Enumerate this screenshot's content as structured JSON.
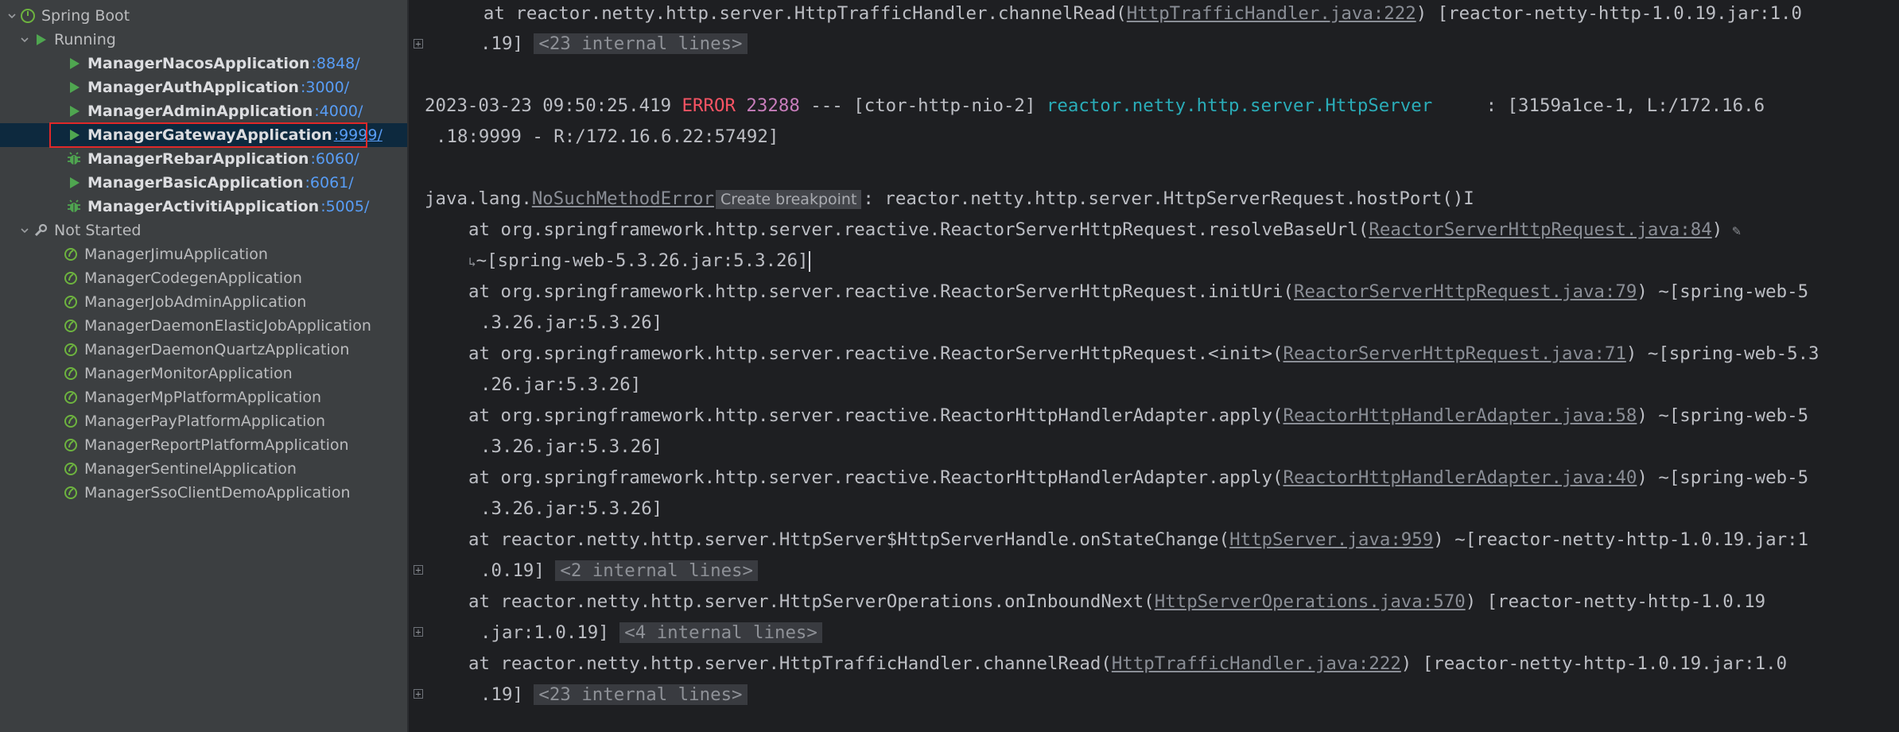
{
  "sidebar": {
    "root": {
      "label": "Spring Boot"
    },
    "running_group": {
      "label": "Running"
    },
    "running": [
      {
        "name": "ManagerNacosApplication",
        "port": ":8848/",
        "icon": "run-icon"
      },
      {
        "name": "ManagerAuthApplication",
        "port": ":3000/",
        "icon": "run-icon"
      },
      {
        "name": "ManagerAdminApplication",
        "port": ":4000/",
        "icon": "run-icon"
      },
      {
        "name": "ManagerGatewayApplication",
        "port": ":9999/",
        "icon": "run-icon",
        "selected": true
      },
      {
        "name": "ManagerRebarApplication",
        "port": ":6060/",
        "icon": "debug-icon"
      },
      {
        "name": "ManagerBasicApplication",
        "port": ":6061/",
        "icon": "run-icon"
      },
      {
        "name": "ManagerActivitiApplication",
        "port": ":5005/",
        "icon": "debug-icon"
      }
    ],
    "not_started_group": {
      "label": "Not Started"
    },
    "not_started": [
      "ManagerJimuApplication",
      "ManagerCodegenApplication",
      "ManagerJobAdminApplication",
      "ManagerDaemonElasticJobApplication",
      "ManagerDaemonQuartzApplication",
      "ManagerMonitorApplication",
      "ManagerMpPlatformApplication",
      "ManagerPayPlatformApplication",
      "ManagerReportPlatformApplication",
      "ManagerSentinelApplication",
      "ManagerSsoClientDemoApplication"
    ]
  },
  "console": {
    "l1": {
      "a": "    at reactor.netty.http.server.HttpTrafficHandler.channelRead(",
      "link": "HttpTrafficHandler.java:222",
      "b": ") [reactor-netty-http-1.0.19.jar:1.0"
    },
    "l2": {
      "a": ".19] ",
      "fold": "<23 internal lines>"
    },
    "l3": {
      "ts": "2023-03-23 09:50:25.419 ",
      "level": "ERROR",
      "sp": " ",
      "pid": "23288",
      "mid": " --- [ctor-http-nio-2] ",
      "logger": "reactor.netty.http.server.HttpServer",
      "msg": "     : [3159a1ce-1, L:/172.16.6"
    },
    "l4": {
      "a": ".18:9999 - R:/172.16.6.22:57492]"
    },
    "l5": {
      "a": "java.lang.",
      "link": "NoSuchMethodError",
      "tip": "Create breakpoint",
      "b": ": reactor.netty.http.server.HttpServerRequest.hostPort()I"
    },
    "l6": {
      "a": "at org.springframework.http.server.reactive.ReactorServerHttpRequest.resolveBaseUrl(",
      "link": "ReactorServerHttpRequest.java:84",
      "b": ")"
    },
    "l7": {
      "a": "~[spring-web-5.3.26.jar:5.3.26]"
    },
    "l8": {
      "a": "at org.springframework.http.server.reactive.ReactorServerHttpRequest.initUri(",
      "link": "ReactorServerHttpRequest.java:79",
      "b": ") ~[spring-web-5"
    },
    "l9": {
      "a": ".3.26.jar:5.3.26]"
    },
    "l10": {
      "a": "at org.springframework.http.server.reactive.ReactorServerHttpRequest.<init>(",
      "link": "ReactorServerHttpRequest.java:71",
      "b": ") ~[spring-web-5.3"
    },
    "l11": {
      "a": ".26.jar:5.3.26]"
    },
    "l12": {
      "a": "at org.springframework.http.server.reactive.ReactorHttpHandlerAdapter.apply(",
      "link": "ReactorHttpHandlerAdapter.java:58",
      "b": ") ~[spring-web-5"
    },
    "l13": {
      "a": ".3.26.jar:5.3.26]"
    },
    "l14": {
      "a": "at org.springframework.http.server.reactive.ReactorHttpHandlerAdapter.apply(",
      "link": "ReactorHttpHandlerAdapter.java:40",
      "b": ") ~[spring-web-5"
    },
    "l15": {
      "a": ".3.26.jar:5.3.26]"
    },
    "l16": {
      "a": "at reactor.netty.http.server.HttpServer$HttpServerHandle.onStateChange(",
      "link": "HttpServer.java:959",
      "b": ") ~[reactor-netty-http-1.0.19.jar:1"
    },
    "l17": {
      "a": ".0.19] ",
      "fold": "<2 internal lines>"
    },
    "l18": {
      "a": "at reactor.netty.http.server.HttpServerOperations.onInboundNext(",
      "link": "HttpServerOperations.java:570",
      "b": ") [reactor-netty-http-1.0.19"
    },
    "l19": {
      "a": ".jar:1.0.19] ",
      "fold": "<4 internal lines>"
    },
    "l20": {
      "a": "at reactor.netty.http.server.HttpTrafficHandler.channelRead(",
      "link": "HttpTrafficHandler.java:222",
      "b": ") [reactor-netty-http-1.0.19.jar:1.0"
    },
    "l21": {
      "a": ".19] ",
      "fold": "<23 internal lines>"
    }
  }
}
